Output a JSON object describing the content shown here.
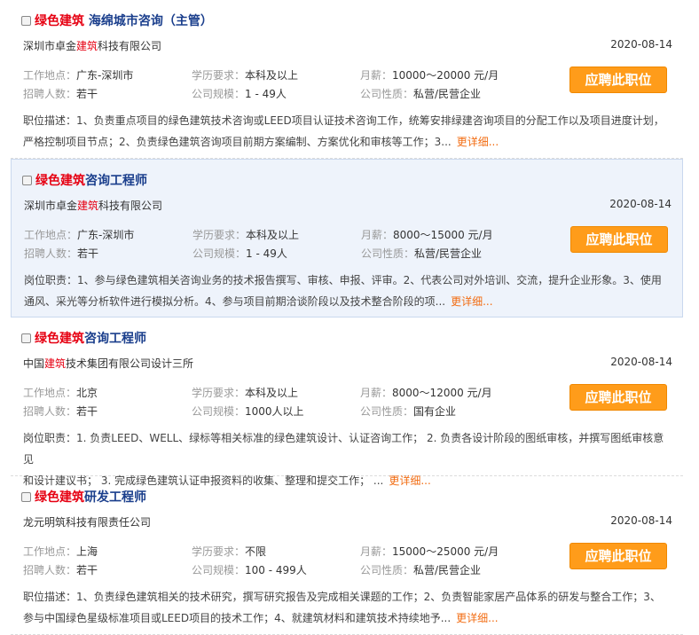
{
  "jobs": [
    {
      "title_kw": "绿色建筑",
      "title_rest": " 海绵城市咨询（主管）",
      "company_pre": "深圳市卓金",
      "company_kw": "建筑",
      "company_post": "科技有限公司",
      "date": "2020-08-14",
      "location_label": "工作地点：",
      "location": "广东-深圳市",
      "edu_label": "学历要求：",
      "edu": "本科及以上",
      "salary_label": "月薪：",
      "salary": "10000～20000 元/月",
      "headcount_label": "招聘人数：",
      "headcount": "若干",
      "size_label": "公司规模：",
      "size": "1 - 49人",
      "nature_label": "公司性质：",
      "nature": "私营/民营企业",
      "apply_label": "应聘此职位",
      "desc_line1": "职位描述：1、负责重点项目的绿色建筑技术咨询或LEED项目认证技术咨询工作，统筹安排绿建咨询项目的分配工作以及项目进度计划，",
      "desc_line2": "严格控制项目节点；2、负责绿色建筑咨询项目前期方案编制、方案优化和审核等工作；3...",
      "more_label": "更详细..."
    },
    {
      "title_kw": "绿色建筑",
      "title_rest": "咨询工程师",
      "company_pre": "深圳市卓金",
      "company_kw": "建筑",
      "company_post": "科技有限公司",
      "date": "2020-08-14",
      "location_label": "工作地点：",
      "location": "广东-深圳市",
      "edu_label": "学历要求：",
      "edu": "本科及以上",
      "salary_label": "月薪：",
      "salary": "8000～15000 元/月",
      "headcount_label": "招聘人数：",
      "headcount": "若干",
      "size_label": "公司规模：",
      "size": "1 - 49人",
      "nature_label": "公司性质：",
      "nature": "私营/民营企业",
      "apply_label": "应聘此职位",
      "desc_line1": "岗位职责：1、参与绿色建筑相关咨询业务的技术报告撰写、审核、申报、评审。2、代表公司对外培训、交流，提升企业形象。3、使用",
      "desc_line2": "通风、采光等分析软件进行模拟分析。4、参与项目前期洽谈阶段以及技术整合阶段的项...",
      "more_label": "更详细..."
    },
    {
      "title_kw": "绿色建筑",
      "title_rest": "咨询工程师",
      "company_pre": "中国",
      "company_kw": "建筑",
      "company_post": "技术集团有限公司设计三所",
      "date": "2020-08-14",
      "location_label": "工作地点：",
      "location": "北京",
      "edu_label": "学历要求：",
      "edu": "本科及以上",
      "salary_label": "月薪：",
      "salary": "8000～12000 元/月",
      "headcount_label": "招聘人数：",
      "headcount": "若干",
      "size_label": "公司规模：",
      "size": "1000人以上",
      "nature_label": "公司性质：",
      "nature": "国有企业",
      "apply_label": "应聘此职位",
      "desc_line1": "岗位职责：1. 负责LEED、WELL、绿标等相关标准的绿色建筑设计、认证咨询工作； 2. 负责各设计阶段的图纸审核，并撰写图纸审核意见",
      "desc_line2": "和设计建议书； 3. 完成绿色建筑认证申报资料的收集、整理和提交工作； ...",
      "more_label": "更详细..."
    },
    {
      "title_kw": "绿色建筑",
      "title_rest": "研发工程师",
      "company_pre": "龙元明筑科技有限责任公司",
      "company_kw": "",
      "company_post": "",
      "date": "2020-08-14",
      "location_label": "工作地点：",
      "location": "上海",
      "edu_label": "学历要求：",
      "edu": "不限",
      "salary_label": "月薪：",
      "salary": "15000～25000 元/月",
      "headcount_label": "招聘人数：",
      "headcount": "若干",
      "size_label": "公司规模：",
      "size": "100 - 499人",
      "nature_label": "公司性质：",
      "nature": "私营/民营企业",
      "apply_label": "应聘此职位",
      "desc_line1": "职位描述：1、负责绿色建筑相关的技术研究，撰写研究报告及完成相关课题的工作；2、负责智能家居产品体系的研发与整合工作；3、",
      "desc_line2": "参与中国绿色星级标准项目或LEED项目的技术工作；4、就建筑材料和建筑技术持续地予...",
      "more_label": "更详细..."
    }
  ]
}
